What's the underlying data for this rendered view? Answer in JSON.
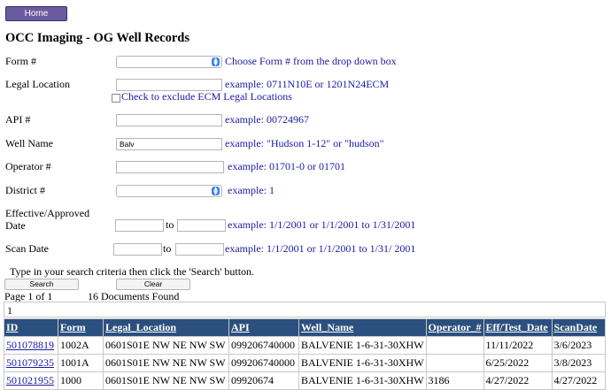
{
  "nav": {
    "home_label": "Home"
  },
  "page_title": "OCC Imaging - OG Well Records",
  "form": {
    "form_no": {
      "label": "Form #",
      "value": "",
      "hint": "Choose Form # from the drop down box"
    },
    "legal_location": {
      "label": "Legal Location",
      "value": "",
      "hint": "example: 0711N10E or 1201N24ECM",
      "exclude_label": "Check to exclude ECM Legal Locations"
    },
    "api": {
      "label": "API #",
      "value": "",
      "hint": "example: 00724967"
    },
    "well_name": {
      "label": "Well Name",
      "value": "Balv",
      "hint": "example: \"Hudson 1-12\" or \"hudson\""
    },
    "operator": {
      "label": "Operator #",
      "value": "",
      "hint": "example: 01701-0 or 01701"
    },
    "district": {
      "label": "District #",
      "value": "",
      "hint": "example: 1"
    },
    "effective": {
      "label_line1": "Effective/Approved",
      "label_line2": "Date",
      "from": "",
      "to_label": "to",
      "to": "",
      "hint": "example: 1/1/2001 or 1/1/2001 to 1/31/2001"
    },
    "scan_date": {
      "label": "Scan Date",
      "from": "",
      "to_label": "to",
      "to": "",
      "hint": "example: 1/1/2001 or 1/1/2001 to 1/31/ 2001"
    }
  },
  "instructions": "Type in your search criteria then click the 'Search' button.",
  "actions": {
    "search_label": "Search",
    "clear_label": "Clear"
  },
  "paging": {
    "page_text": "Page 1 of 1",
    "found_text": "16 Documents Found",
    "page_number": "1"
  },
  "table": {
    "headers": [
      "ID",
      "Form",
      "Legal_Location",
      "API",
      "Well_Name",
      "Operator_#",
      "Eff/Test_Date",
      "ScanDate"
    ],
    "rows": [
      [
        "501078819",
        "1002A",
        "0601S01E NW NE NW SW",
        "099206740000",
        "BALVENIE 1-6-31-30XHW",
        "",
        "11/11/2022",
        "3/6/2023"
      ],
      [
        "501079235",
        "1001A",
        "0601S01E NW NE NW SW",
        "099206740000",
        "BALVENIE 1-6-31-30XHW",
        "",
        "6/25/2022",
        "3/8/2023"
      ],
      [
        "501021955",
        "1000",
        "0601S01E NW NE NW SW",
        "09920674",
        "BALVENIE 1-6-31-30XHW",
        "3186",
        "4/27/2022",
        "4/27/2022"
      ]
    ]
  },
  "colors": {
    "header_bg": "#2b4f7e",
    "link": "#1a1aa6",
    "home_bg": "#6a5a9e"
  }
}
